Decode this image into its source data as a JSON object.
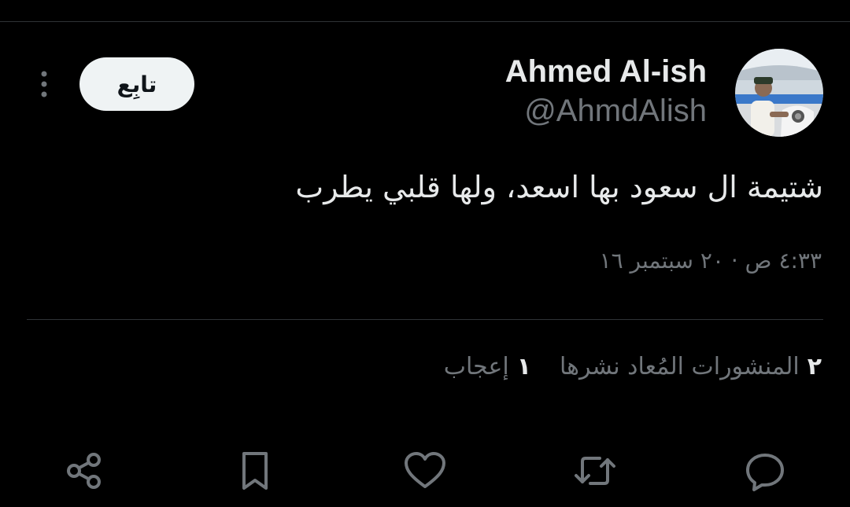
{
  "tweet": {
    "author": {
      "display_name": "Ahmed Al-ish",
      "handle": "@AhmdAlish"
    },
    "follow_label": "تابِع",
    "text": "شتيمة ال سعود بها اسعد، ولها قلبي يطرب",
    "timestamp": "٤:٣٣ ص · ٢٠ سبتمبر ١٦",
    "stats": {
      "reposts_count": "٢",
      "reposts_label": "المنشورات المُعاد نشرها",
      "likes_count": "١",
      "likes_label": "إعجاب"
    }
  },
  "icons": {
    "more": "more-vertical-icon",
    "share": "share-icon",
    "bookmark": "bookmark-icon",
    "like": "heart-icon",
    "repost": "repost-icon",
    "reply": "reply-icon"
  },
  "colors": {
    "background": "#000000",
    "text_primary": "#e7e9ea",
    "text_secondary": "#71767b",
    "divider": "#2f3336",
    "follow_bg": "#eff3f4",
    "follow_text": "#0f1419"
  }
}
